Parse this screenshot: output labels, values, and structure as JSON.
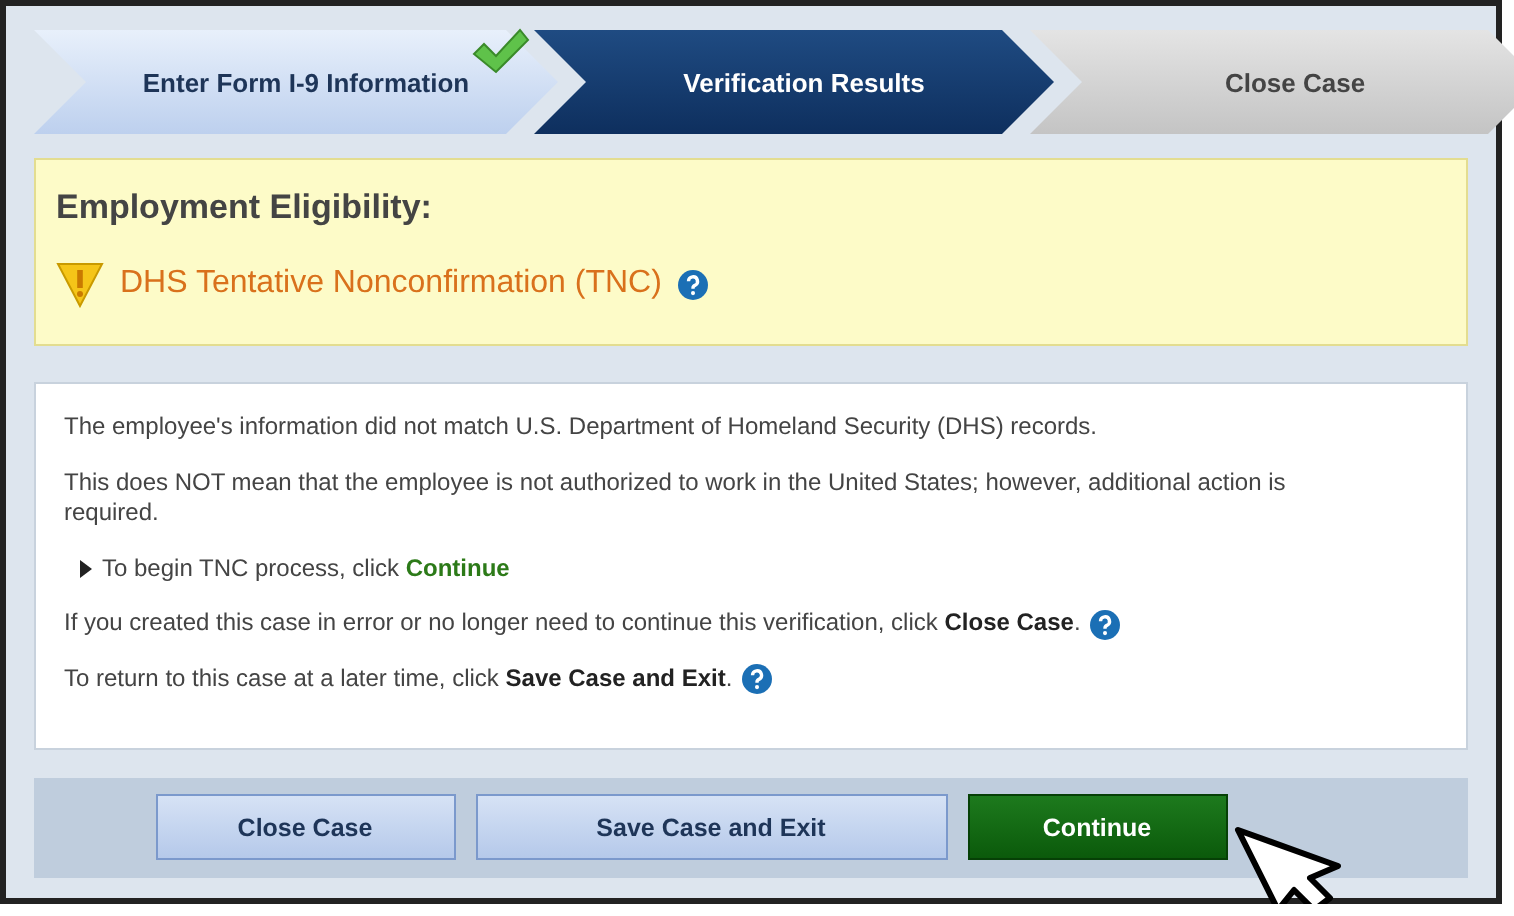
{
  "steps": [
    {
      "label": "Enter Form I-9 Information",
      "completed": true,
      "selected": false
    },
    {
      "label": "Verification Results",
      "completed": false,
      "selected": true
    },
    {
      "label": "Close Case",
      "completed": false,
      "selected": false
    }
  ],
  "eligibility": {
    "heading": "Employment Eligibility:",
    "result": "DHS Tentative Nonconfirmation (TNC)",
    "help": true
  },
  "messages": [
    {
      "kind": "text",
      "text": "The employee's information did not match U.S. Department of Homeland Security (DHS) records.",
      "help": false
    },
    {
      "kind": "text",
      "text": "This does NOT mean that the employee is not authorized to work in the United States; however, additional action is required.",
      "help": false
    },
    {
      "kind": "bullet",
      "text": "To begin TNC process, click **Continue**",
      "help": false
    },
    {
      "kind": "text",
      "text": "If you created this case in error or no longer need to continue this verification, click **Close Case**.",
      "help": true
    },
    {
      "kind": "text",
      "text": "To return to this case at a later time, click **Save Case and Exit**.",
      "help": true
    }
  ],
  "buttons": [
    {
      "label": "Close Case",
      "kind": "secondary"
    },
    {
      "label": "Save Case and Exit",
      "kind": "secondary"
    },
    {
      "label": "Continue",
      "kind": "primary"
    }
  ]
}
